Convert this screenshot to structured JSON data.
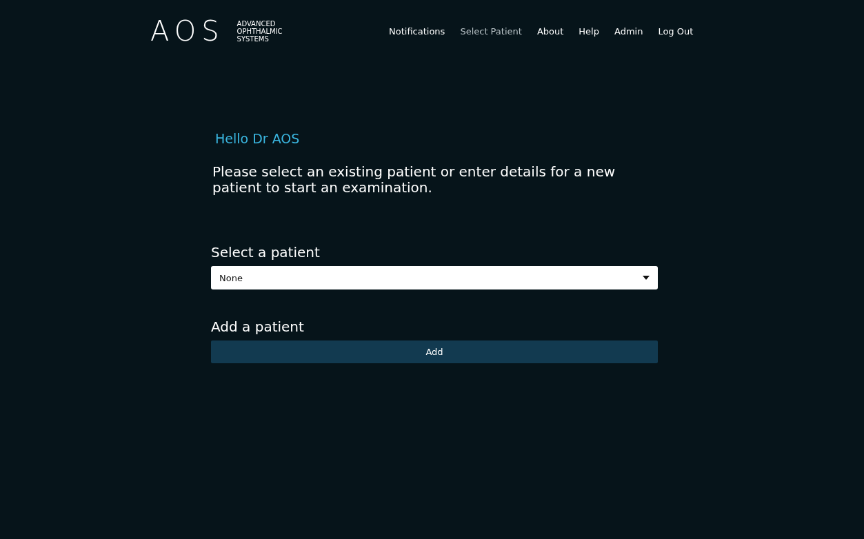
{
  "logo": {
    "mark": "AOS",
    "tagline": [
      "ADVANCED",
      "OPHTHALMIC",
      "SYSTEMS"
    ]
  },
  "nav": [
    {
      "label": "Notifications",
      "selected": false
    },
    {
      "label": "Select Patient",
      "selected": true
    },
    {
      "label": "About",
      "selected": false
    },
    {
      "label": "Help",
      "selected": false
    },
    {
      "label": "Admin",
      "selected": false
    },
    {
      "label": "Log Out",
      "selected": false
    }
  ],
  "greeting": "Hello Dr AOS",
  "intro": "Please select an existing patient or enter details for a new patient to start an examination.",
  "select_section": {
    "heading": "Select a patient",
    "value": "None"
  },
  "add_section": {
    "heading": "Add a patient",
    "button": "Add"
  }
}
